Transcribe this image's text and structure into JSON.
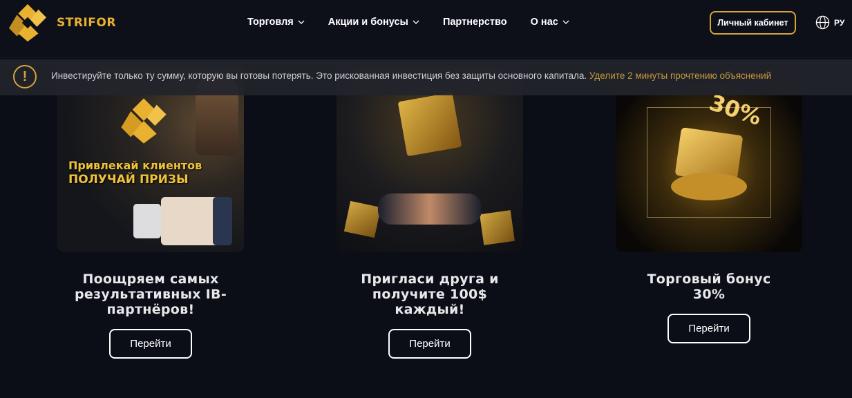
{
  "brand": {
    "name": "STRIFOR",
    "color": "#e9b130"
  },
  "nav": {
    "items": [
      {
        "label": "Торговля",
        "dropdown": true
      },
      {
        "label": "Акции и бонусы",
        "dropdown": true
      },
      {
        "label": "Партнерство",
        "dropdown": false
      },
      {
        "label": "О нас",
        "dropdown": true
      }
    ]
  },
  "header": {
    "cabinet_label": "Личный кабинет",
    "lang": "РУ"
  },
  "warning": {
    "icon": "exclamation",
    "text": "Инвестируйте только ту сумму, которую вы готовы потерять. Это рискованная инвестиция без защиты основного капитала.",
    "link": "Уделите 2 минуты прочтению объяснений"
  },
  "cards": [
    {
      "title": "Поощряем самых результативных IB-партнёров!",
      "image_line1": "Привлекай клиентов",
      "image_line2": "ПОЛУЧАЙ ПРИЗЫ",
      "button": "Перейти"
    },
    {
      "title": "Пригласи друга и получите 100$ каждый!",
      "button": "Перейти"
    },
    {
      "title": "Торговый бонус 30%",
      "image_badge": "30%",
      "button": "Перейти"
    }
  ],
  "colors": {
    "accent": "#d9a33a",
    "background": "#0b0e17"
  }
}
